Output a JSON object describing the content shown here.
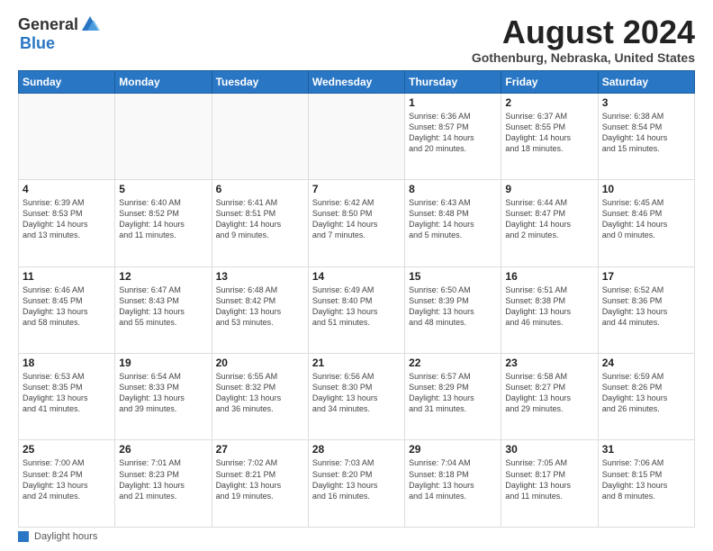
{
  "logo": {
    "general": "General",
    "blue": "Blue"
  },
  "title": "August 2024",
  "subtitle": "Gothenburg, Nebraska, United States",
  "days_of_week": [
    "Sunday",
    "Monday",
    "Tuesday",
    "Wednesday",
    "Thursday",
    "Friday",
    "Saturday"
  ],
  "footer_label": "Daylight hours",
  "weeks": [
    [
      {
        "day": "",
        "info": ""
      },
      {
        "day": "",
        "info": ""
      },
      {
        "day": "",
        "info": ""
      },
      {
        "day": "",
        "info": ""
      },
      {
        "day": "1",
        "info": "Sunrise: 6:36 AM\nSunset: 8:57 PM\nDaylight: 14 hours\nand 20 minutes."
      },
      {
        "day": "2",
        "info": "Sunrise: 6:37 AM\nSunset: 8:55 PM\nDaylight: 14 hours\nand 18 minutes."
      },
      {
        "day": "3",
        "info": "Sunrise: 6:38 AM\nSunset: 8:54 PM\nDaylight: 14 hours\nand 15 minutes."
      }
    ],
    [
      {
        "day": "4",
        "info": "Sunrise: 6:39 AM\nSunset: 8:53 PM\nDaylight: 14 hours\nand 13 minutes."
      },
      {
        "day": "5",
        "info": "Sunrise: 6:40 AM\nSunset: 8:52 PM\nDaylight: 14 hours\nand 11 minutes."
      },
      {
        "day": "6",
        "info": "Sunrise: 6:41 AM\nSunset: 8:51 PM\nDaylight: 14 hours\nand 9 minutes."
      },
      {
        "day": "7",
        "info": "Sunrise: 6:42 AM\nSunset: 8:50 PM\nDaylight: 14 hours\nand 7 minutes."
      },
      {
        "day": "8",
        "info": "Sunrise: 6:43 AM\nSunset: 8:48 PM\nDaylight: 14 hours\nand 5 minutes."
      },
      {
        "day": "9",
        "info": "Sunrise: 6:44 AM\nSunset: 8:47 PM\nDaylight: 14 hours\nand 2 minutes."
      },
      {
        "day": "10",
        "info": "Sunrise: 6:45 AM\nSunset: 8:46 PM\nDaylight: 14 hours\nand 0 minutes."
      }
    ],
    [
      {
        "day": "11",
        "info": "Sunrise: 6:46 AM\nSunset: 8:45 PM\nDaylight: 13 hours\nand 58 minutes."
      },
      {
        "day": "12",
        "info": "Sunrise: 6:47 AM\nSunset: 8:43 PM\nDaylight: 13 hours\nand 55 minutes."
      },
      {
        "day": "13",
        "info": "Sunrise: 6:48 AM\nSunset: 8:42 PM\nDaylight: 13 hours\nand 53 minutes."
      },
      {
        "day": "14",
        "info": "Sunrise: 6:49 AM\nSunset: 8:40 PM\nDaylight: 13 hours\nand 51 minutes."
      },
      {
        "day": "15",
        "info": "Sunrise: 6:50 AM\nSunset: 8:39 PM\nDaylight: 13 hours\nand 48 minutes."
      },
      {
        "day": "16",
        "info": "Sunrise: 6:51 AM\nSunset: 8:38 PM\nDaylight: 13 hours\nand 46 minutes."
      },
      {
        "day": "17",
        "info": "Sunrise: 6:52 AM\nSunset: 8:36 PM\nDaylight: 13 hours\nand 44 minutes."
      }
    ],
    [
      {
        "day": "18",
        "info": "Sunrise: 6:53 AM\nSunset: 8:35 PM\nDaylight: 13 hours\nand 41 minutes."
      },
      {
        "day": "19",
        "info": "Sunrise: 6:54 AM\nSunset: 8:33 PM\nDaylight: 13 hours\nand 39 minutes."
      },
      {
        "day": "20",
        "info": "Sunrise: 6:55 AM\nSunset: 8:32 PM\nDaylight: 13 hours\nand 36 minutes."
      },
      {
        "day": "21",
        "info": "Sunrise: 6:56 AM\nSunset: 8:30 PM\nDaylight: 13 hours\nand 34 minutes."
      },
      {
        "day": "22",
        "info": "Sunrise: 6:57 AM\nSunset: 8:29 PM\nDaylight: 13 hours\nand 31 minutes."
      },
      {
        "day": "23",
        "info": "Sunrise: 6:58 AM\nSunset: 8:27 PM\nDaylight: 13 hours\nand 29 minutes."
      },
      {
        "day": "24",
        "info": "Sunrise: 6:59 AM\nSunset: 8:26 PM\nDaylight: 13 hours\nand 26 minutes."
      }
    ],
    [
      {
        "day": "25",
        "info": "Sunrise: 7:00 AM\nSunset: 8:24 PM\nDaylight: 13 hours\nand 24 minutes."
      },
      {
        "day": "26",
        "info": "Sunrise: 7:01 AM\nSunset: 8:23 PM\nDaylight: 13 hours\nand 21 minutes."
      },
      {
        "day": "27",
        "info": "Sunrise: 7:02 AM\nSunset: 8:21 PM\nDaylight: 13 hours\nand 19 minutes."
      },
      {
        "day": "28",
        "info": "Sunrise: 7:03 AM\nSunset: 8:20 PM\nDaylight: 13 hours\nand 16 minutes."
      },
      {
        "day": "29",
        "info": "Sunrise: 7:04 AM\nSunset: 8:18 PM\nDaylight: 13 hours\nand 14 minutes."
      },
      {
        "day": "30",
        "info": "Sunrise: 7:05 AM\nSunset: 8:17 PM\nDaylight: 13 hours\nand 11 minutes."
      },
      {
        "day": "31",
        "info": "Sunrise: 7:06 AM\nSunset: 8:15 PM\nDaylight: 13 hours\nand 8 minutes."
      }
    ]
  ]
}
